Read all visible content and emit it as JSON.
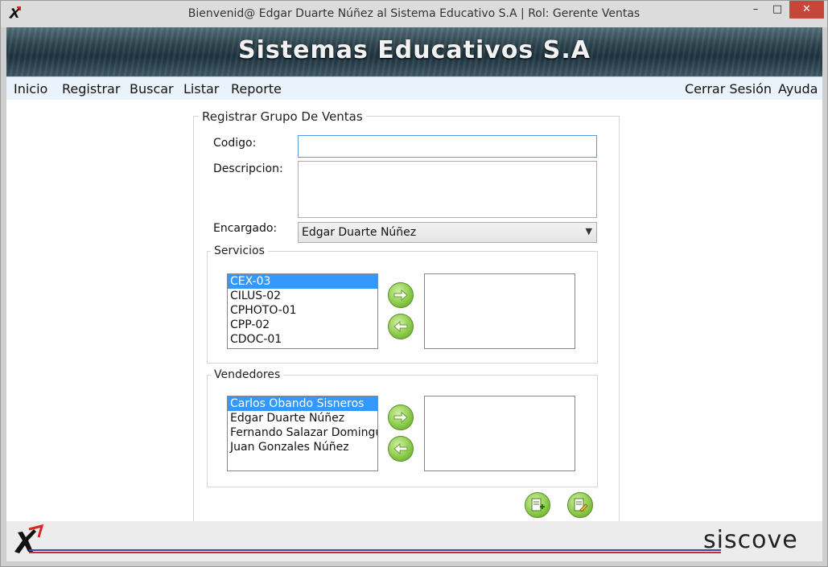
{
  "window": {
    "title": "Bienvenid@ Edgar Duarte Núñez al Sistema Educativo S.A  |  Rol: Gerente Ventas",
    "minimize": "–",
    "maximize": "□",
    "close": "✕"
  },
  "banner": {
    "title": "Sistemas Educativos S.A"
  },
  "menu": {
    "left": [
      "Inicio",
      "Registrar",
      "Buscar",
      "Listar",
      "Reporte"
    ],
    "right": [
      "Cerrar Sesión",
      "Ayuda"
    ]
  },
  "form": {
    "legend": "Registrar Grupo De Ventas",
    "codigo_label": "Codigo:",
    "codigo_value": "",
    "descripcion_label": "Descripcion:",
    "descripcion_value": "",
    "encargado_label": "Encargado:",
    "encargado_value": "Edgar Duarte Núñez",
    "servicios": {
      "legend": "Servicios",
      "available": [
        "CEX-03",
        "CILUS-02",
        "CPHOTO-01",
        "CPP-02",
        "CDOC-01"
      ],
      "selected_index": 0,
      "assigned": []
    },
    "vendedores": {
      "legend": "Vendedores",
      "available": [
        "Carlos Obando Sisneros",
        "Edgar Duarte Núñez",
        "Fernando Salazar Domingue",
        "Juan Gonzales Núñez"
      ],
      "selected_index": 0,
      "assigned": []
    }
  },
  "footer": {
    "brand": "siscove"
  },
  "colors": {
    "accent": "#3399ff",
    "button_green": "#8ccc4a",
    "close_red": "#c7463a",
    "menu_bg": "#eaf3fb"
  }
}
